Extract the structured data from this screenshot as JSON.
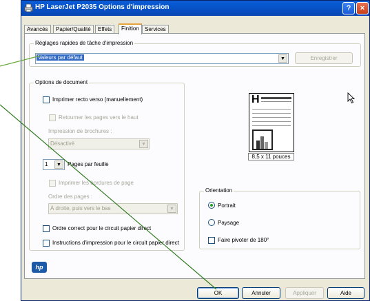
{
  "window": {
    "title": "HP LaserJet P2035 Options d'impression",
    "help_btn": "?",
    "close_btn": "×"
  },
  "tabs": [
    "Avancés",
    "Papier/Qualité",
    "Effets",
    "Finition",
    "Services"
  ],
  "active_tab": "Finition",
  "quick_sets": {
    "legend": "Réglages rapides de tâche d'impression",
    "selected": "Valeurs par défaut",
    "save_button": "Enregistrer"
  },
  "doc_options": {
    "legend": "Options de document",
    "duplex": "Imprimer recto verso (manuellement)",
    "flip_pages": "Retourner les pages vers le haut",
    "booklet_label": "Impression de brochures :",
    "booklet_value": "Désactivé",
    "pages_per_sheet_value": "1",
    "pages_per_sheet_label": "Pages par feuille",
    "print_borders": "Imprimer les bordures de page",
    "page_order_label": "Ordre des pages :",
    "page_order_value": "À droite, puis vers le bas",
    "correct_order": "Ordre correct pour le circuit papier direct",
    "instructions": "Instructions d'impression pour le circuit papier direct"
  },
  "preview": {
    "glyph": "H",
    "size_label": "8,5 x 11 pouces"
  },
  "orientation": {
    "legend": "Orientation",
    "portrait": "Portrait",
    "landscape": "Paysage",
    "rotate": "Faire pivoter de 180°",
    "selected": "Portrait"
  },
  "footer": {
    "logo": "hp",
    "ok": "OK",
    "cancel": "Annuler",
    "apply": "Appliquer",
    "help": "Aide"
  },
  "icons": [
    "printer-icon",
    "help-icon",
    "close-icon",
    "dropdown-arrow-icon",
    "mouse-cursor-icon",
    "hp-logo-icon"
  ]
}
